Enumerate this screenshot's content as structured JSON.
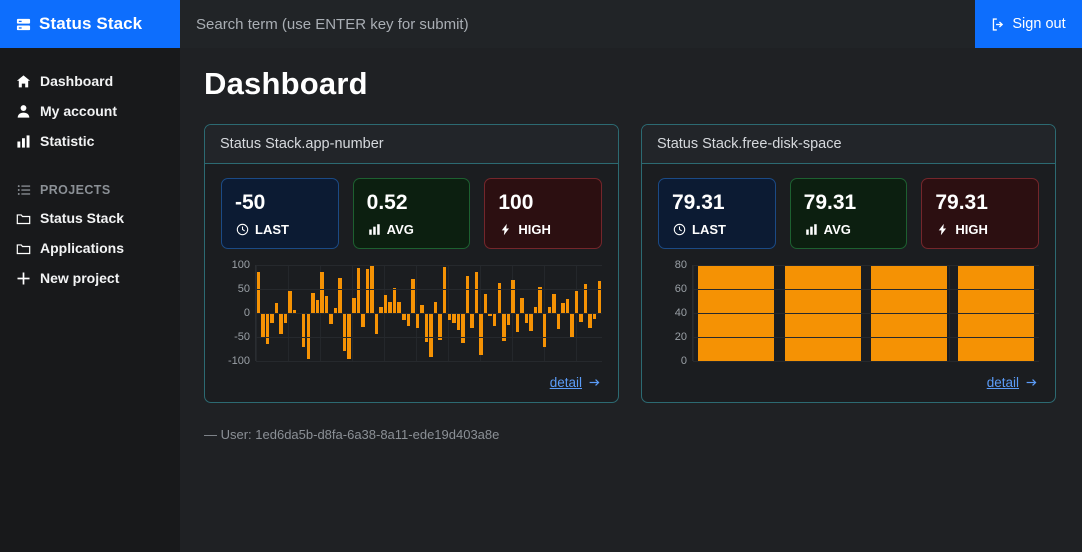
{
  "brand": {
    "label": "Status Stack",
    "icon": "server-stack-icon",
    "bg": "#0d6efd"
  },
  "sidebar": {
    "items": [
      {
        "label": "Dashboard",
        "icon": "home-icon"
      },
      {
        "label": "My account",
        "icon": "user-icon"
      },
      {
        "label": "Statistic",
        "icon": "bar-chart-icon"
      }
    ],
    "section": {
      "label": "PROJECTS",
      "icon": "list-icon"
    },
    "projects": [
      {
        "label": "Status Stack",
        "icon": "folder-icon"
      },
      {
        "label": "Applications",
        "icon": "folder-icon"
      }
    ],
    "new_project": {
      "label": "New project",
      "icon": "plus-icon"
    }
  },
  "topbar": {
    "search_placeholder": "Search term (use ENTER key for submit)",
    "search_value": "",
    "signout_label": "Sign out",
    "signout_icon": "sign-out-icon"
  },
  "page": {
    "title": "Dashboard"
  },
  "cards": [
    {
      "title": "Status Stack.app-number",
      "stats": [
        {
          "value": "-50",
          "label": "LAST",
          "icon": "clock-icon",
          "kind": "last"
        },
        {
          "value": "0.52",
          "label": "AVG",
          "icon": "bar-chart-icon",
          "kind": "avg"
        },
        {
          "value": "100",
          "label": "HIGH",
          "icon": "bolt-icon",
          "kind": "high"
        }
      ],
      "detail_label": "detail",
      "detail_icon": "arrow-right-icon"
    },
    {
      "title": "Status Stack.free-disk-space",
      "stats": [
        {
          "value": "79.31",
          "label": "LAST",
          "icon": "clock-icon",
          "kind": "last"
        },
        {
          "value": "79.31",
          "label": "AVG",
          "icon": "bar-chart-icon",
          "kind": "avg"
        },
        {
          "value": "79.31",
          "label": "HIGH",
          "icon": "bolt-icon",
          "kind": "high"
        }
      ],
      "detail_label": "detail",
      "detail_icon": "arrow-right-icon"
    }
  ],
  "footer": {
    "text": "—  User: 1ed6da5b-d8fa-6a38-8a11-ede19d403a8e"
  },
  "colors": {
    "accent_blue": "#0d6efd",
    "bar_orange": "#f59204",
    "card_border": "#2c6a72",
    "link_blue": "#5b9cf8",
    "sidebar_bg": "#18191b",
    "main_bg": "#1f2124"
  },
  "chart_data": [
    {
      "type": "bar",
      "title": "Status Stack.app-number",
      "xlabel": "",
      "ylabel": "",
      "ylim": [
        -100,
        100
      ],
      "yticks": [
        100,
        50,
        0,
        -50,
        -100
      ],
      "grid": true,
      "legend": "none",
      "categories": [],
      "values": [
        85,
        -50,
        -65,
        -20,
        22,
        -43,
        -20,
        47,
        6,
        -2,
        -71,
        -96,
        42,
        28,
        85,
        35,
        -22,
        10,
        73,
        -78,
        -96,
        31,
        95,
        -28,
        93,
        98,
        -44,
        13,
        38,
        24,
        52,
        23,
        -14,
        -26,
        71,
        -30,
        17,
        -60,
        -92,
        24,
        -55,
        96,
        -14,
        -20,
        -36,
        -62,
        78,
        -30,
        86,
        -88,
        40,
        -5,
        -26,
        63,
        -58,
        -24,
        70,
        -40,
        32,
        -20,
        -38,
        12,
        55,
        -70,
        13,
        40,
        -34,
        22,
        30,
        -52,
        46,
        -18,
        61,
        -30,
        -12,
        66
      ]
    },
    {
      "type": "bar",
      "title": "Status Stack.free-disk-space",
      "xlabel": "",
      "ylabel": "",
      "ylim": [
        0,
        80
      ],
      "yticks": [
        80,
        60,
        40,
        20,
        0
      ],
      "grid": true,
      "legend": "none",
      "categories": [
        "",
        "",
        "",
        ""
      ],
      "values": [
        79.31,
        79.31,
        79.31,
        79.31
      ]
    }
  ]
}
